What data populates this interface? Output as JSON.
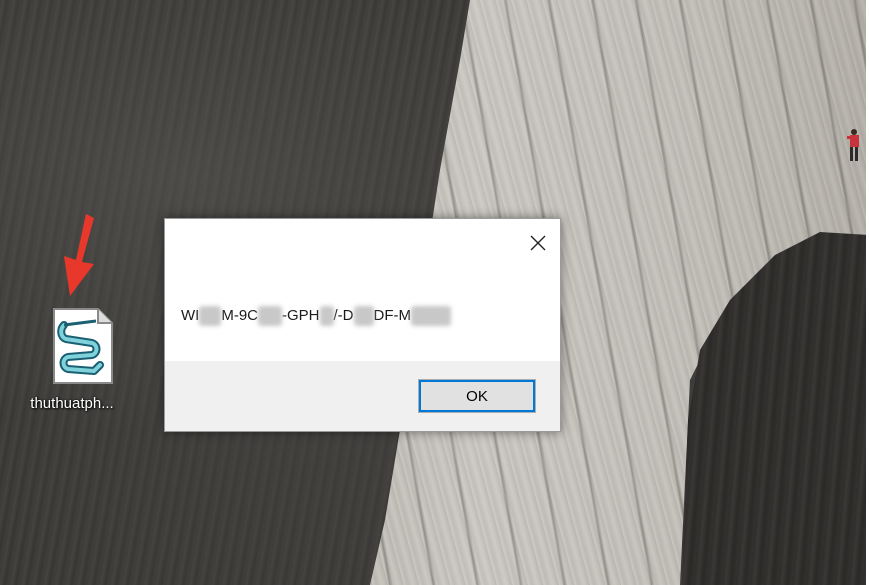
{
  "desktop": {
    "icon": {
      "label": "thuthuatph...",
      "icon_name": "script-file-icon"
    },
    "pointer_arrow_color": "#e8372b"
  },
  "message_box": {
    "segments": [
      "WI",
      "M-9C",
      "-GPH",
      "/-D",
      "DF-M",
      ""
    ],
    "ok_label": "OK",
    "close_icon": "close-icon",
    "accent": "#0078d7"
  }
}
